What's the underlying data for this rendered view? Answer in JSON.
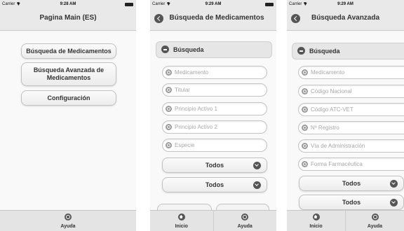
{
  "status_bar": {
    "carrier": "Carrier",
    "time_1": "9:28 AM",
    "time_2": "9:29 AM",
    "time_3": "9:29 AM"
  },
  "screen_main": {
    "title": "Pagina Main (ES)",
    "buttons": [
      {
        "label": "Búsqueda de Medicamentos"
      },
      {
        "label": "Búsqueda Avanzada de Medicamentos"
      },
      {
        "label": "Configuración"
      }
    ],
    "nav": {
      "help_label": "Ayuda"
    }
  },
  "screen_search": {
    "title": "Búsqueda de Medicamentos",
    "section_label": "Búsqueda",
    "placeholders": [
      "Medicamento",
      "Titular",
      "Principio Activo 1",
      "Principio Activo 2",
      "Especie"
    ],
    "selects": [
      {
        "value": "Todos"
      },
      {
        "value": "Todos"
      }
    ],
    "nav": {
      "home_label": "Inicio",
      "help_label": "Ayuda"
    }
  },
  "screen_advanced": {
    "title": "Búsqueda Avanzada",
    "section_label": "Búsqueda",
    "placeholders": [
      "Medicamento",
      "Código Nacional",
      "Código ATC-VET",
      "Nº Registro",
      "Vía de Administración",
      "Forma Farmacéutica"
    ],
    "selects": [
      {
        "value": "Todos"
      },
      {
        "value": "Todos"
      }
    ],
    "nav": {
      "home_label": "Inicio",
      "help_label": "Ayuda"
    }
  },
  "icons": {
    "back": "back-arrow-icon",
    "collapse": "minus-circle-icon",
    "search": "search-icon",
    "chevron": "chevron-down-icon",
    "home": "home-icon",
    "help": "globe-icon"
  }
}
